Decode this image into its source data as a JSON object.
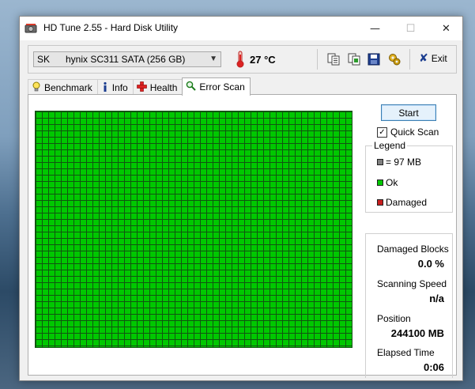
{
  "window": {
    "title": "HD Tune 2.55 - Hard Disk Utility",
    "controls": {
      "minimize_icon": "minimize-icon",
      "maximize_icon": "maximize-icon",
      "close_icon": "close-icon"
    }
  },
  "toolbar": {
    "drive_selected": "SK      hynix SC311 SATA (256 GB)",
    "temperature": "27 °C",
    "icons": [
      "copy-text-icon",
      "copy-screenshot-icon",
      "save-icon",
      "options-icon"
    ],
    "exit_label": "Exit"
  },
  "tabs": [
    {
      "label": "Benchmark",
      "icon": "lightbulb-icon",
      "active": false
    },
    {
      "label": "Info",
      "icon": "info-icon",
      "active": false
    },
    {
      "label": "Health",
      "icon": "health-cross-icon",
      "active": false
    },
    {
      "label": "Error Scan",
      "icon": "magnifier-icon",
      "active": true
    }
  ],
  "error_scan": {
    "start_label": "Start",
    "quick_scan_label": "Quick Scan",
    "quick_scan_checked": true,
    "block_status": "all ok",
    "legend": {
      "title": "Legend",
      "items": [
        {
          "label": "= 97 MB",
          "color": "#808080"
        },
        {
          "label": "Ok",
          "color": "#00c800"
        },
        {
          "label": "Damaged",
          "color": "#c81e1e"
        }
      ]
    },
    "stats": {
      "damaged_blocks_label": "Damaged Blocks",
      "damaged_blocks_value": "0.0 %",
      "scanning_speed_label": "Scanning Speed",
      "scanning_speed_value": "n/a",
      "position_label": "Position",
      "position_value": "244100 MB",
      "elapsed_time_label": "Elapsed Time",
      "elapsed_time_value": "0:06"
    }
  },
  "colors": {
    "ok_block": "#00c800",
    "grid_line": "#115511",
    "accent_button": "#3c7fb1"
  }
}
